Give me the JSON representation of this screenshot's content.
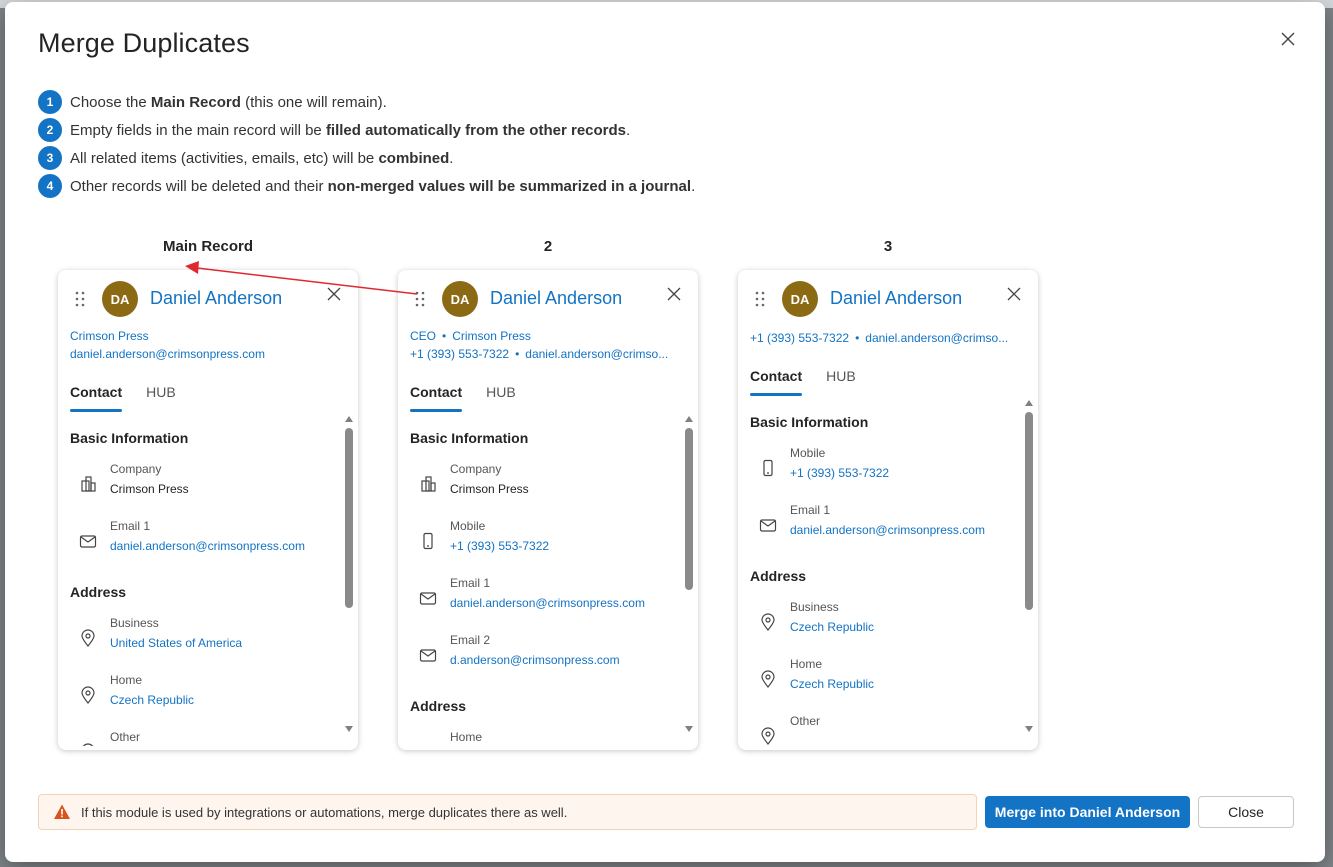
{
  "dialog": {
    "title": "Merge Duplicates",
    "steps": [
      {
        "num": "1",
        "pre": "Choose the ",
        "bold": "Main Record",
        "post": " (this one will remain)."
      },
      {
        "num": "2",
        "pre": "Empty fields in the main record will be ",
        "bold": "filled automatically from the other records",
        "post": "."
      },
      {
        "num": "3",
        "pre": "All related items (activities, emails, etc) will be ",
        "bold": "combined",
        "post": "."
      },
      {
        "num": "4",
        "pre": "Other records will be deleted and their ",
        "bold": "non-merged values will be summarized in a journal",
        "post": "."
      }
    ],
    "notice": "If this module is used by integrations or automations, merge duplicates there as well.",
    "merge_button": "Merge into Daniel Anderson",
    "close_button": "Close"
  },
  "colors": {
    "accent": "#1373c4",
    "avatar": "#8c6a14",
    "warning": "#d9531e",
    "arrow": "#e0282e"
  },
  "cards": [
    {
      "header": "Main Record",
      "initials": "DA",
      "name": "Daniel Anderson",
      "meta_line1": [
        "Crimson Press"
      ],
      "meta_line2": [
        "daniel.anderson@crimsonpress.com"
      ],
      "tabs": [
        "Contact",
        "HUB"
      ],
      "sections": [
        {
          "title": "Basic Information",
          "fields": [
            {
              "icon": "building-icon",
              "label": "Company",
              "value": "Crimson Press",
              "link": false
            },
            {
              "icon": "mail-icon",
              "label": "Email 1",
              "value": "daniel.anderson@crimsonpress.com",
              "link": true
            }
          ]
        },
        {
          "title": "Address",
          "fields": [
            {
              "icon": "location-pin-icon",
              "label": "Business",
              "value": "United States of America",
              "link": true
            },
            {
              "icon": "location-pin-icon",
              "label": "Home",
              "value": "Czech Republic",
              "link": true
            },
            {
              "icon": "location-pin-icon",
              "label": "Other",
              "value": "",
              "link": true
            }
          ]
        }
      ]
    },
    {
      "header": "2",
      "initials": "DA",
      "name": "Daniel Anderson",
      "meta_line1": [
        "CEO",
        "Crimson Press"
      ],
      "meta_line2": [
        "+1 (393) 553-7322",
        "daniel.anderson@crimso..."
      ],
      "tabs": [
        "Contact",
        "HUB"
      ],
      "sections": [
        {
          "title": "Basic Information",
          "fields": [
            {
              "icon": "building-icon",
              "label": "Company",
              "value": "Crimson Press",
              "link": false
            },
            {
              "icon": "mobile-phone-icon",
              "label": "Mobile",
              "value": "+1 (393) 553-7322",
              "link": true
            },
            {
              "icon": "mail-icon",
              "label": "Email 1",
              "value": "daniel.anderson@crimsonpress.com",
              "link": true
            },
            {
              "icon": "mail-icon",
              "label": "Email 2",
              "value": "d.anderson@crimsonpress.com",
              "link": true
            }
          ]
        },
        {
          "title": "Address",
          "fields": [
            {
              "icon": "location-pin-icon",
              "label": "Home",
              "value": "",
              "link": true
            }
          ]
        }
      ]
    },
    {
      "header": "3",
      "initials": "DA",
      "name": "Daniel Anderson",
      "meta_line1": [
        "+1 (393) 553-7322",
        "daniel.anderson@crimso..."
      ],
      "meta_line2": [],
      "tabs": [
        "Contact",
        "HUB"
      ],
      "sections": [
        {
          "title": "Basic Information",
          "fields": [
            {
              "icon": "mobile-phone-icon",
              "label": "Mobile",
              "value": "+1 (393) 553-7322",
              "link": true
            },
            {
              "icon": "mail-icon",
              "label": "Email 1",
              "value": "daniel.anderson@crimsonpress.com",
              "link": true
            }
          ]
        },
        {
          "title": "Address",
          "fields": [
            {
              "icon": "location-pin-icon",
              "label": "Business",
              "value": "Czech Republic",
              "link": true
            },
            {
              "icon": "location-pin-icon",
              "label": "Home",
              "value": "Czech Republic",
              "link": true
            },
            {
              "icon": "location-pin-icon",
              "label": "Other",
              "value": "",
              "link": true
            }
          ]
        }
      ]
    }
  ]
}
